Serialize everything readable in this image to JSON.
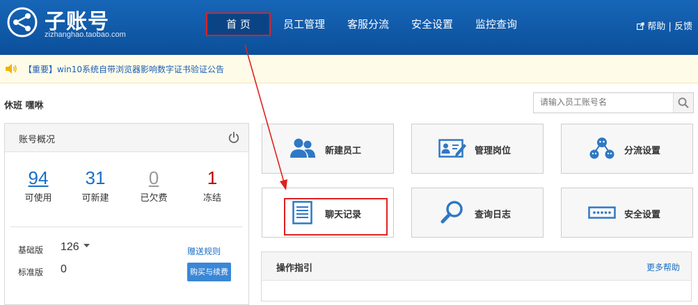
{
  "header": {
    "logo_title": "子账号",
    "logo_subtitle": "zizhanghao.taobao.com",
    "nav": [
      "首 页",
      "员工管理",
      "客服分流",
      "安全设置",
      "监控查询"
    ],
    "help_label": "帮助",
    "separator": "|",
    "feedback_label": "反馈"
  },
  "notice": {
    "text": "【重要】win10系统自带浏览器影响数字证书验证公告"
  },
  "user": {
    "name": "休班 嘿咻"
  },
  "search": {
    "placeholder": "请输入员工账号名"
  },
  "account_panel": {
    "title": "账号概况",
    "stats": [
      {
        "value": "94",
        "label": "可使用",
        "color": "#1a6fc4"
      },
      {
        "value": "31",
        "label": "可新建",
        "color": "#1a6fc4"
      },
      {
        "value": "0",
        "label": "已欠费",
        "color": "#999999"
      },
      {
        "value": "1",
        "label": "冻结",
        "color": "#c00000"
      }
    ],
    "basic_label": "基础版",
    "basic_value": "126",
    "standard_label": "标准版",
    "standard_value": "0",
    "gift_rule": "赠送规则",
    "buy_button": "购买与续费"
  },
  "tiles": [
    {
      "label": "新建员工",
      "icon": "users-icon"
    },
    {
      "label": "管理岗位",
      "icon": "id-card-icon"
    },
    {
      "label": "分流设置",
      "icon": "distribution-icon"
    },
    {
      "label": "聊天记录",
      "icon": "document-icon"
    },
    {
      "label": "查询日志",
      "icon": "magnifier-icon"
    },
    {
      "label": "安全设置",
      "icon": "password-icon"
    }
  ],
  "guide": {
    "title": "操作指引",
    "more": "更多帮助"
  },
  "colors": {
    "header_bg": "#0d5aa8",
    "accent": "#1a6fc4",
    "highlight": "#e0201f"
  }
}
